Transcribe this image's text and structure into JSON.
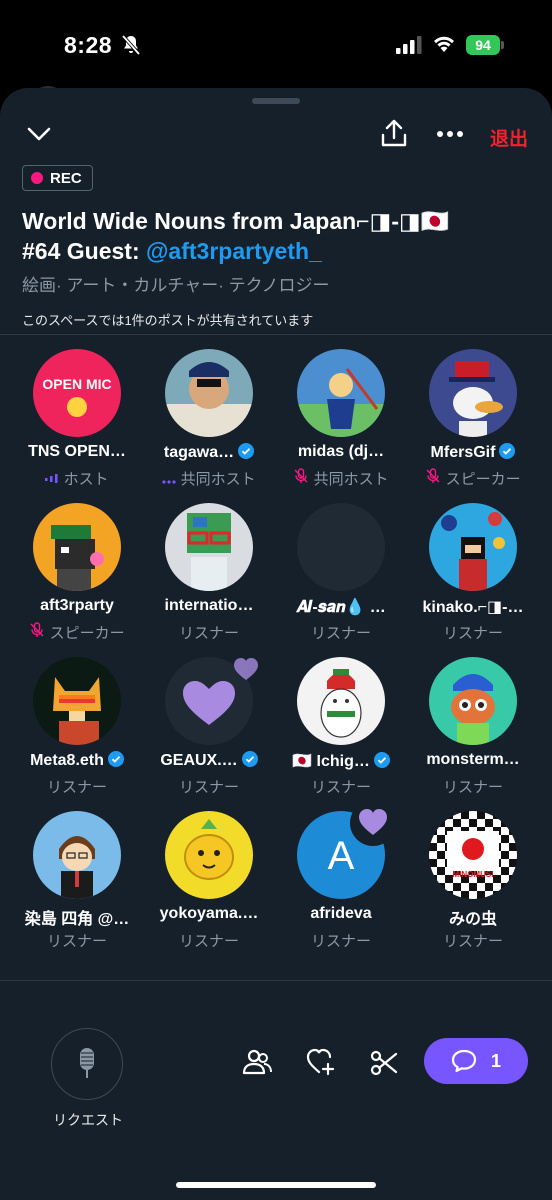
{
  "status": {
    "time": "8:28",
    "battery": "94"
  },
  "header": {
    "leave_label": "退出"
  },
  "space": {
    "rec_label": "REC",
    "title_line1": "World Wide Nouns from Japan⌐◨-◨🇯🇵",
    "title_line2_prefix": "#64 Guest: ",
    "title_mention": "@aft3rpartyeth_",
    "topics": "絵画· アート・カルチャー· テクノロジー",
    "posts_note": "このスペースでは1件のポストが共有されています"
  },
  "participants": [
    {
      "name": "TNS OPEN…",
      "role": "ホスト",
      "avatar_text": "OPEN MIC"
    },
    {
      "name": "tagawa…",
      "role": "共同ホスト",
      "verified": true
    },
    {
      "name": "midas (dj…",
      "role": "共同ホスト",
      "muted": true
    },
    {
      "name": "MfersGif",
      "role": "スピーカー",
      "verified": true,
      "muted": true
    },
    {
      "name": "aft3rparty",
      "role": "スピーカー",
      "muted": true
    },
    {
      "name": "internatio…",
      "role": "リスナー"
    },
    {
      "name": "𝑨𝑰-𝒔𝒂𝒏💧 …",
      "role": "リスナー"
    },
    {
      "name": "kinako.⌐◨-…",
      "role": "リスナー"
    },
    {
      "name": "Meta8.eth",
      "role": "リスナー",
      "verified": true
    },
    {
      "name": "GEAUX.…",
      "role": "リスナー",
      "verified": true
    },
    {
      "name": "🇯🇵 Ichig…",
      "role": "リスナー",
      "verified": true
    },
    {
      "name": "monsterm…",
      "role": "リスナー"
    },
    {
      "name": "染島 四角 @…",
      "role": "リスナー"
    },
    {
      "name": "yokoyama.…",
      "role": "リスナー"
    },
    {
      "name": "afrideva",
      "role": "リスナー",
      "avatar_text": "A"
    },
    {
      "name": "みの虫",
      "role": "リスナー",
      "avatar_text": "MINOMUSI"
    }
  ],
  "footer": {
    "request_label": "リクエスト",
    "comment_count": "1"
  },
  "colors": {
    "accent": "#1d9bf0",
    "leave": "#f4212e",
    "rec": "#f91880",
    "comment": "#7856ff",
    "sheet": "#15202b"
  }
}
